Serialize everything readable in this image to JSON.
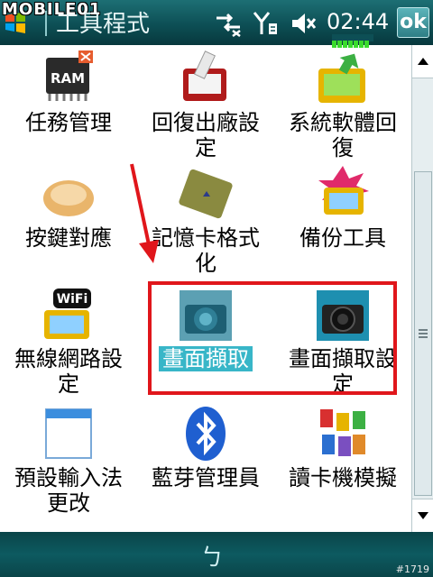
{
  "header": {
    "watermark": "MOBILE01",
    "title": "工具程式",
    "time": "02:44",
    "ok_label": "ok"
  },
  "apps": [
    {
      "label_lines": [
        "任務管理"
      ],
      "icon": "ram-icon",
      "icon_text": "RAM"
    },
    {
      "label_lines": [
        "回復出廠設",
        "定"
      ],
      "icon": "factory-reset-icon"
    },
    {
      "label_lines": [
        "系統軟體回",
        "復"
      ],
      "icon": "system-restore-icon"
    },
    {
      "label_lines": [
        "按鍵對應"
      ],
      "icon": "key-mapping-icon"
    },
    {
      "label_lines": [
        "記憶卡格式",
        "化"
      ],
      "icon": "memory-card-icon"
    },
    {
      "label_lines": [
        "備份工具"
      ],
      "icon": "backup-icon"
    },
    {
      "label_lines": [
        "無線網路設",
        "定"
      ],
      "icon": "wifi-settings-icon",
      "icon_text": "WiFi"
    },
    {
      "label_lines": [
        "畫面擷取"
      ],
      "icon": "screen-capture-icon",
      "selected": true
    },
    {
      "label_lines": [
        "畫面擷取設",
        "定"
      ],
      "icon": "screen-capture-settings-icon"
    },
    {
      "label_lines": [
        "預設輸入法",
        "更改"
      ],
      "icon": "input-method-icon"
    },
    {
      "label_lines": [
        "藍芽管理員"
      ],
      "icon": "bluetooth-icon"
    },
    {
      "label_lines": [
        "讀卡機模擬"
      ],
      "icon": "card-reader-icon"
    }
  ],
  "footer": {
    "softkey_glyph": "ㄅ",
    "tag": "#1719"
  },
  "colors": {
    "header_top": "#1d6f74",
    "header_bottom": "#07383d",
    "highlight": "#e0161b",
    "selection": "#38b6c8"
  }
}
